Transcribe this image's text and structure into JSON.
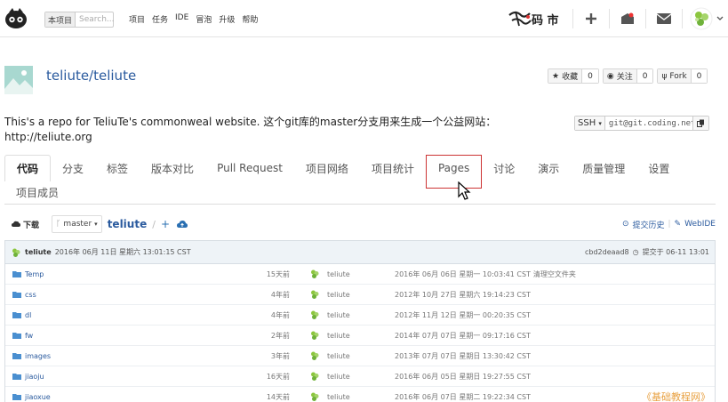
{
  "topnav": {
    "search_scope": "本项目",
    "search_placeholder": "Search...",
    "links": [
      "项目",
      "任务",
      "IDE",
      "冒泡",
      "升级",
      "帮助"
    ],
    "brand_text": "码 市",
    "icons": [
      "plus-icon",
      "notification-icon",
      "mail-icon",
      "user-avatar"
    ]
  },
  "repo": {
    "title": "teliute/teliute",
    "buttons": [
      {
        "icon": "star-icon",
        "label": "收藏",
        "count": "0"
      },
      {
        "icon": "eye-icon",
        "label": "关注",
        "count": "0"
      },
      {
        "icon": "fork-icon",
        "label": "Fork",
        "count": "0"
      }
    ],
    "description": "This's a repo for TeliuTe's commonweal website. 这个git库的master分支用来生成一个公益网站： http://teliute.org",
    "clone": {
      "protocol": "SSH",
      "url": "git@git.coding.net"
    }
  },
  "tabs": {
    "row1": [
      "代码",
      "分支",
      "标签",
      "版本对比",
      "Pull Request",
      "项目网络",
      "项目统计",
      "Pages",
      "讨论",
      "演示",
      "质量管理",
      "设置"
    ],
    "row2": [
      "项目成员"
    ],
    "active": "代码",
    "highlighted": "Pages"
  },
  "toolbar": {
    "download": "下载",
    "branch": "master",
    "crumb": "teliute",
    "slash": "/",
    "plus": "+",
    "history": "提交历史",
    "webide": "WebIDE"
  },
  "commit": {
    "author": "teliute",
    "time": "2016年 06月 11日 星期六 13:01:15 CST",
    "hash": "cbd2deaad8",
    "submitted": "提交于 06-11 13:01"
  },
  "files": [
    {
      "name": "Temp",
      "ago": "15天前",
      "user": "teliute",
      "date": "2016年 06月 06日 星期一 10:03:41 CST",
      "msg": "清理空文件夹"
    },
    {
      "name": "css",
      "ago": "4年前",
      "user": "teliute",
      "date": "2012年 10月 27日 星期六 19:14:23 CST",
      "msg": ""
    },
    {
      "name": "dl",
      "ago": "4年前",
      "user": "teliute",
      "date": "2012年 11月 12日 星期一 00:20:35 CST",
      "msg": ""
    },
    {
      "name": "fw",
      "ago": "2年前",
      "user": "teliute",
      "date": "2014年 07月 07日 星期一 09:17:16 CST",
      "msg": ""
    },
    {
      "name": "images",
      "ago": "3年前",
      "user": "teliute",
      "date": "2013年 07月 07日 星期日 13:30:42 CST",
      "msg": ""
    },
    {
      "name": "jiaoju",
      "ago": "16天前",
      "user": "teliute",
      "date": "2016年 06月 05日 星期日 19:27:55 CST",
      "msg": ""
    },
    {
      "name": "jiaoxue",
      "ago": "14天前",
      "user": "teliute",
      "date": "2016年 06月 07日 星期二 19:22:34 CST",
      "msg": ""
    }
  ],
  "watermark": "《基础教程网》",
  "colors": {
    "link": "#2a5a9e",
    "highlight_border": "#cc3333",
    "folder": "#4a8fd0"
  }
}
